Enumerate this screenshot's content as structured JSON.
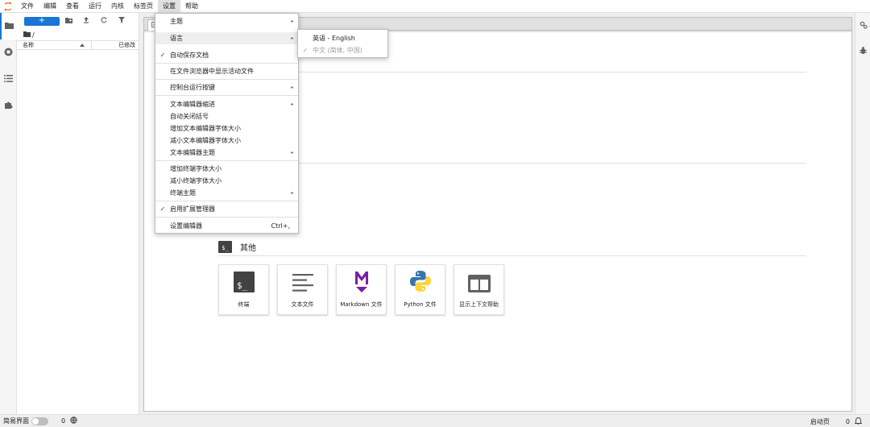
{
  "menubar": {
    "items": [
      "文件",
      "编辑",
      "查看",
      "运行",
      "内核",
      "标签页",
      "设置",
      "帮助"
    ]
  },
  "file_browser": {
    "new_label": "+",
    "breadcrumb": "/",
    "col_name": "名称",
    "col_modified": "已修改"
  },
  "launcher": {
    "section_title": "其他",
    "section_icon_text": "$_",
    "cards": [
      {
        "label": "终端",
        "icon": "terminal-icon"
      },
      {
        "label": "文本文件",
        "icon": "text-file-icon"
      },
      {
        "label": "Markdown 文件",
        "icon": "markdown-icon"
      },
      {
        "label": "Python 文件",
        "icon": "python-icon"
      },
      {
        "label": "显示上下文帮助",
        "icon": "context-help-icon"
      }
    ]
  },
  "settings_menu": {
    "items": [
      {
        "label": "主题",
        "submenu": true,
        "checked": false
      },
      {
        "label": "语言",
        "submenu": true,
        "checked": false
      },
      {
        "label": "自动保存文档",
        "submenu": false,
        "checked": true
      },
      {
        "label": "在文件浏览器中显示活动文件",
        "submenu": false,
        "checked": false
      },
      {
        "label": "控制台运行按键",
        "submenu": true,
        "checked": false
      },
      {
        "label": "文本编辑器缩进",
        "submenu": true,
        "checked": false
      },
      {
        "label": "自动关闭括号",
        "submenu": false,
        "checked": false
      },
      {
        "label": "增加文本编辑器字体大小",
        "submenu": false,
        "checked": false
      },
      {
        "label": "减小文本编辑器字体大小",
        "submenu": false,
        "checked": false
      },
      {
        "label": "文本编辑器主题",
        "submenu": true,
        "checked": false
      },
      {
        "label": "增加终端字体大小",
        "submenu": false,
        "checked": false
      },
      {
        "label": "减小终端字体大小",
        "submenu": false,
        "checked": false
      },
      {
        "label": "终端主题",
        "submenu": true,
        "checked": false
      },
      {
        "label": "启用扩展管理器",
        "submenu": false,
        "checked": true
      },
      {
        "label": "设置编辑器",
        "submenu": false,
        "checked": false,
        "shortcut": "Ctrl+,"
      }
    ]
  },
  "language_menu": {
    "items": [
      {
        "label": "英语 - English",
        "checked": false,
        "disabled": false
      },
      {
        "label": "中文 (简体, 中国)",
        "checked": true,
        "disabled": true
      }
    ]
  },
  "statusbar": {
    "simple_mode_label": "简易界面",
    "kernel_count": "0",
    "launcher_label": "启动页",
    "notification_count": "0"
  },
  "colors": {
    "accent": "#1976d2",
    "python_blue": "#3776ab",
    "python_yellow": "#ffd43b",
    "markdown_purple": "#7b1fa2"
  }
}
